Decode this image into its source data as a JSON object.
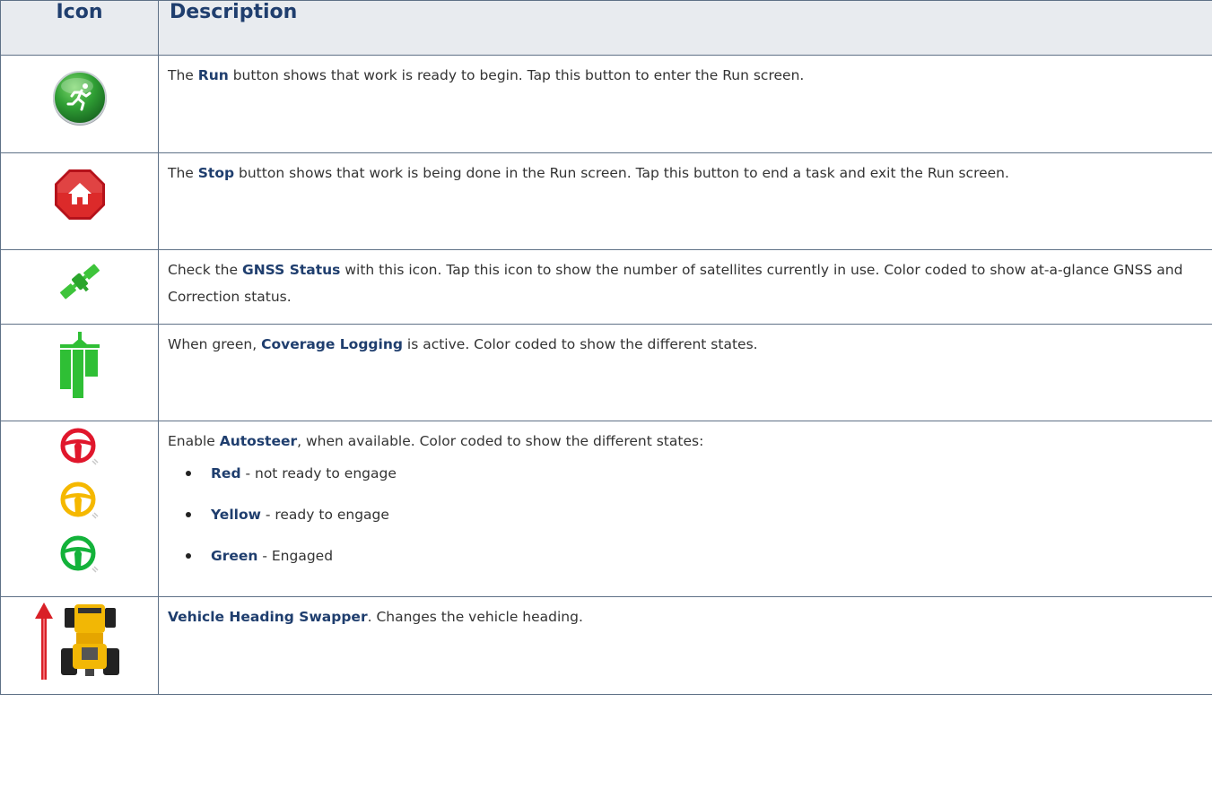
{
  "table": {
    "headers": [
      "Icon",
      "Description"
    ],
    "rows": [
      {
        "icon": "run-button-icon",
        "pre": "The ",
        "bold": "Run",
        "post": " button shows that work is ready to begin. Tap this button to enter the Run screen."
      },
      {
        "icon": "stop-button-icon",
        "pre": "The ",
        "bold": "Stop",
        "post": " button shows that work is being done in the Run screen. Tap this button to end a task and exit the Run screen."
      },
      {
        "icon": "gnss-satellite-icon",
        "pre": "Check the ",
        "bold": "GNSS Status",
        "post": " with this icon. Tap this icon to show the number of satellites currently in use. Color coded to show at-a-glance GNSS and Correction status."
      },
      {
        "icon": "coverage-logging-icon",
        "pre": "When green, ",
        "bold": "Coverage Logging",
        "post": " is active. Color coded to show the different states."
      },
      {
        "icon": "autosteer-icons",
        "pre": "Enable ",
        "bold": "Autosteer",
        "post": ", when available. Color coded to show the different states:",
        "states": [
          {
            "label": "Red",
            "text": " - not ready to engage",
            "color": "#e0172c"
          },
          {
            "label": "Yellow",
            "text": " - ready to engage",
            "color": "#f5b800"
          },
          {
            "label": "Green",
            "text": " - Engaged",
            "color": "#13b23a"
          }
        ]
      },
      {
        "icon": "vehicle-heading-swapper-icon",
        "pre": "",
        "bold": "Vehicle Heading Swapper",
        "post": ". Changes the vehicle heading."
      }
    ]
  },
  "colors": {
    "heading_text": "#1f3e6e",
    "header_bg": "#e8ebef",
    "border": "#5f7187"
  }
}
